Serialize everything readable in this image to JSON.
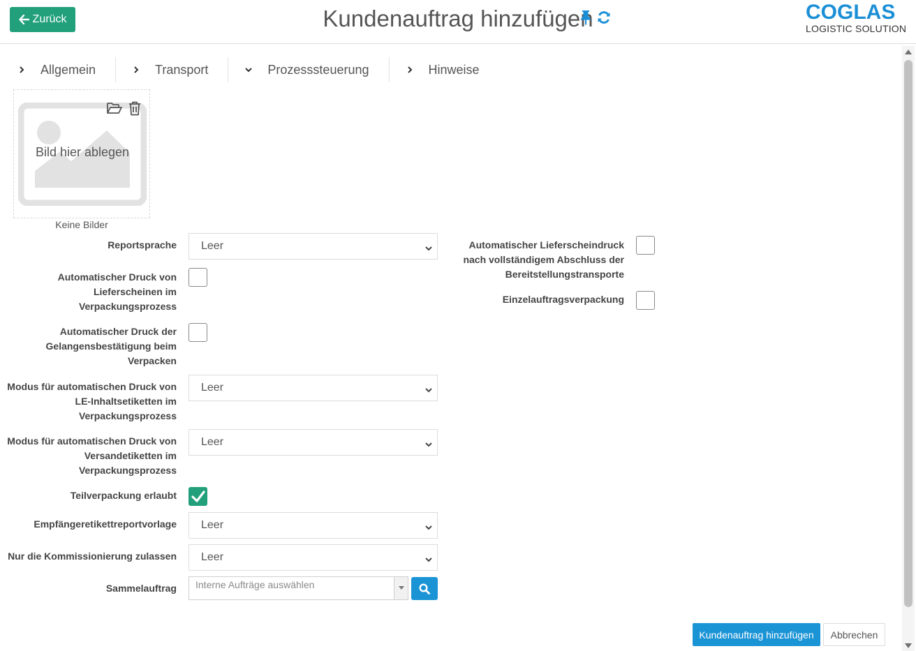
{
  "header": {
    "back_label": "Zurück",
    "title": "Kundenauftrag hinzufügen",
    "logo_main": "COGLAS",
    "logo_sub": "LOGISTIC SOLUTION"
  },
  "tabs": [
    {
      "label": "Allgemein",
      "state": "collapsed"
    },
    {
      "label": "Transport",
      "state": "collapsed"
    },
    {
      "label": "Prozesssteuerung",
      "state": "expanded"
    },
    {
      "label": "Hinweise",
      "state": "collapsed"
    }
  ],
  "image_upload": {
    "drop_text": "Bild hier ablegen",
    "no_images_text": "Keine Bilder"
  },
  "form_left": {
    "reportsprache": {
      "label": "Reportsprache",
      "value": "Leer"
    },
    "auto_druck_lieferscheine": {
      "label_lines": [
        "Automatischer Druck von",
        "Lieferscheinen im",
        "Verpackungsprozess"
      ],
      "checked": false
    },
    "auto_druck_gelangen": {
      "label_lines": [
        "Automatischer Druck der",
        "Gelangensbestätigung beim",
        "Verpacken"
      ],
      "checked": false
    },
    "modus_le_inhalt": {
      "label_lines": [
        "Modus für automatischen Druck von",
        "LE-Inhaltsetiketten im",
        "Verpackungsprozess"
      ],
      "value": "Leer"
    },
    "modus_versand": {
      "label_lines": [
        "Modus für automatischen Druck von",
        "Versandetiketten im",
        "Verpackungsprozess"
      ],
      "value": "Leer"
    },
    "teilverpackung": {
      "label": "Teilverpackung erlaubt",
      "checked": true
    },
    "empfaenger_report": {
      "label": "Empfängeretikettreportvorlage",
      "value": "Leer"
    },
    "nur_kommissionierung": {
      "label": "Nur die Kommissionierung zulassen",
      "value": "Leer"
    },
    "sammelauftrag": {
      "label": "Sammelauftrag",
      "placeholder": "Interne Aufträge auswählen"
    }
  },
  "form_right": {
    "auto_lieferscheindruck": {
      "label_lines": [
        "Automatischer Lieferscheindruck",
        "nach vollständigem Abschluss der",
        "Bereitstellungstransporte"
      ],
      "checked": false
    },
    "einzelauftrag": {
      "label": "Einzelauftragsverpackung",
      "checked": false
    }
  },
  "footer": {
    "submit_label": "Kundenauftrag hinzufügen",
    "cancel_label": "Abbrechen"
  },
  "colors": {
    "green": "#21a07b",
    "blue": "#1b94d6",
    "logo_blue": "#1b8fd6"
  }
}
